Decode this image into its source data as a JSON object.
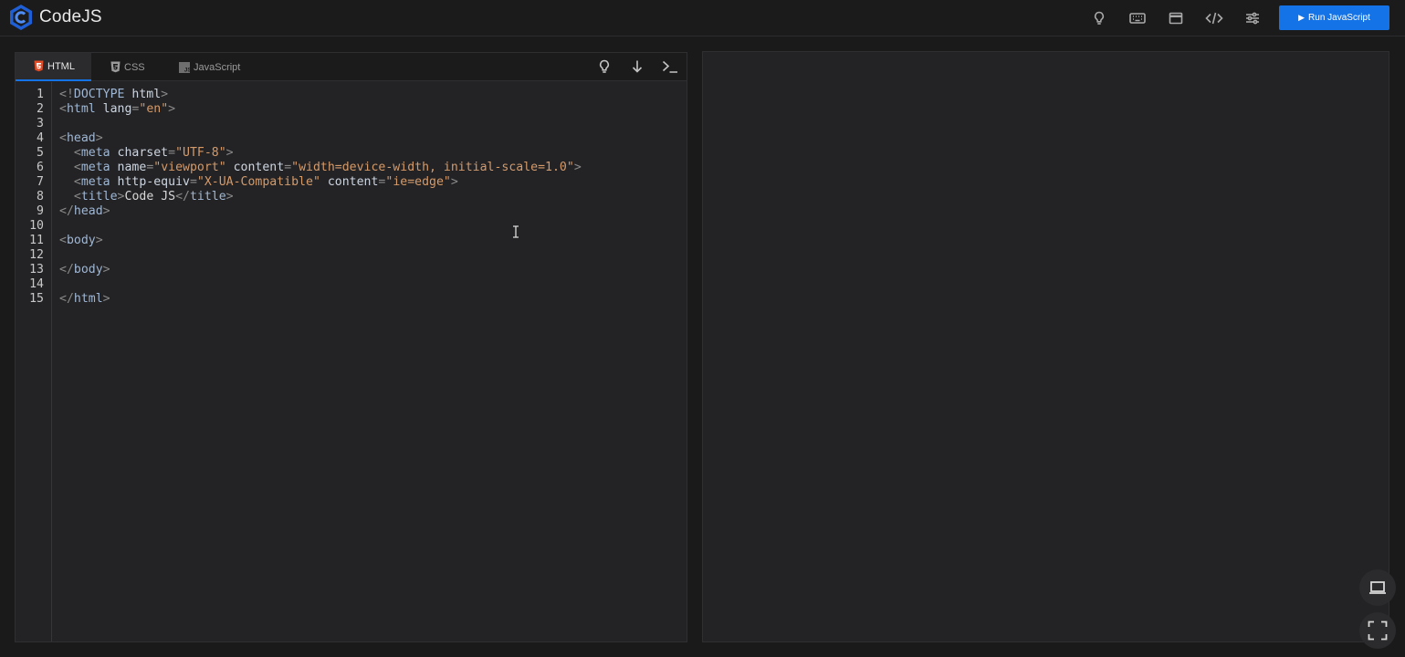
{
  "app": {
    "name": "CodeJS"
  },
  "header": {
    "icons": [
      "lightbulb-icon",
      "keyboard-icon",
      "window-icon",
      "code-icon",
      "sliders-icon"
    ],
    "run_label": "Run JavaScript"
  },
  "editor": {
    "tabs": [
      {
        "label": "HTML",
        "icon": "html5-icon",
        "active": true
      },
      {
        "label": "CSS",
        "icon": "css3-icon",
        "active": false
      },
      {
        "label": "JavaScript",
        "icon": "js-icon",
        "active": false
      }
    ],
    "tools": [
      "lightbulb-icon",
      "arrow-down-icon",
      "terminal-icon"
    ],
    "line_numbers": [
      "1",
      "2",
      "3",
      "4",
      "5",
      "6",
      "7",
      "8",
      "9",
      "10",
      "11",
      "12",
      "13",
      "14",
      "15"
    ],
    "code": {
      "l1": {
        "open": "<!",
        "tag": "DOCTYPE",
        "rest": " html",
        "close": ">"
      },
      "l2": {
        "open": "<",
        "tag": "html",
        "attr": " lang",
        "eq": "=",
        "val": "\"en\"",
        "close": ">"
      },
      "l4": {
        "open": "<",
        "tag": "head",
        "close": ">"
      },
      "l5": {
        "indent": "  ",
        "open": "<",
        "tag": "meta",
        "attr": " charset",
        "eq": "=",
        "val": "\"UTF-8\"",
        "close": ">"
      },
      "l6": {
        "indent": "  ",
        "open": "<",
        "tag": "meta",
        "attr1": " name",
        "eq1": "=",
        "val1": "\"viewport\"",
        "attr2": " content",
        "eq2": "=",
        "val2": "\"width=device-width, initial-scale=1.0\"",
        "close": ">"
      },
      "l7": {
        "indent": "  ",
        "open": "<",
        "tag": "meta",
        "attr1": " http-equiv",
        "eq1": "=",
        "val1": "\"X-UA-Compatible\"",
        "attr2": " content",
        "eq2": "=",
        "val2": "\"ie=edge\"",
        "close": ">"
      },
      "l8": {
        "indent": "  ",
        "open": "<",
        "tag": "title",
        "close": ">",
        "text": "Code JS",
        "open2": "</",
        "tag2": "title",
        "close2": ">"
      },
      "l9": {
        "open": "</",
        "tag": "head",
        "close": ">"
      },
      "l11": {
        "open": "<",
        "tag": "body",
        "close": ">"
      },
      "l13": {
        "open": "</",
        "tag": "body",
        "close": ">"
      },
      "l15": {
        "open": "</",
        "tag": "html",
        "close": ">"
      }
    }
  },
  "floating": [
    "laptop-icon",
    "fullscreen-icon"
  ],
  "colors": {
    "accent": "#1473e6",
    "background": "#1a1a1b",
    "panel": "#232325"
  }
}
